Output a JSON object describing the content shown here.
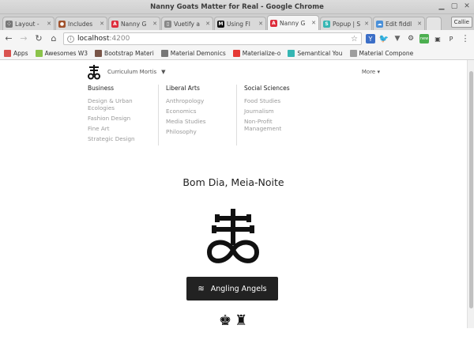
{
  "window": {
    "title": "Nanny Goats Matter for Real - Google Chrome"
  },
  "tabs": [
    {
      "label": "Layout -",
      "color": "#777777",
      "glyph": "⁘"
    },
    {
      "label": "Includes",
      "color": "#a0522d",
      "glyph": "●"
    },
    {
      "label": "Nanny G",
      "color": "#dd2c3b",
      "glyph": "A"
    },
    {
      "label": "Vuetify a",
      "color": "#888888",
      "glyph": "▯"
    },
    {
      "label": "Using Fl",
      "color": "#111111",
      "glyph": "M"
    },
    {
      "label": "Nanny G",
      "color": "#dd2c3b",
      "glyph": "A",
      "active": true
    },
    {
      "label": "Popup | S",
      "color": "#35b6b3",
      "glyph": "S"
    },
    {
      "label": "Edit fiddl",
      "color": "#4a90d9",
      "glyph": "☁"
    }
  ],
  "profile": "Callie",
  "omnibox": {
    "host": "localhost",
    "port": ":4200"
  },
  "bookmarks": [
    {
      "label": "Apps",
      "color": "#d9534f"
    },
    {
      "label": "Awesomes W3",
      "color": "#8bc34a"
    },
    {
      "label": "Bootstrap Materi",
      "color": "#795548"
    },
    {
      "label": "Material Demonics",
      "color": "#777777"
    },
    {
      "label": "Materialize-o",
      "color": "#e53935"
    },
    {
      "label": "Semantical You",
      "color": "#35b6b3"
    },
    {
      "label": "Material Compone",
      "color": "#9e9e9e"
    }
  ],
  "header": {
    "brand": "Curriculum Mortis",
    "more": "More"
  },
  "menu": [
    {
      "heading": "Business",
      "items": [
        "Design & Urban Ecologies",
        "Fashion Design",
        "Fine Art",
        "Strategic Design"
      ]
    },
    {
      "heading": "Liberal Arts",
      "items": [
        "Anthropology",
        "Economics",
        "Media Studies",
        "Philosophy"
      ]
    },
    {
      "heading": "Social Sciences",
      "items": [
        "Food Studies",
        "Journalism",
        "Non-Profit Management"
      ]
    }
  ],
  "greeting": "Bom Dia, Meia-Noite",
  "cta": {
    "label": "Angling Angels",
    "icon": "waves-icon"
  },
  "icons": {
    "chess": [
      "♚",
      "♜"
    ]
  }
}
